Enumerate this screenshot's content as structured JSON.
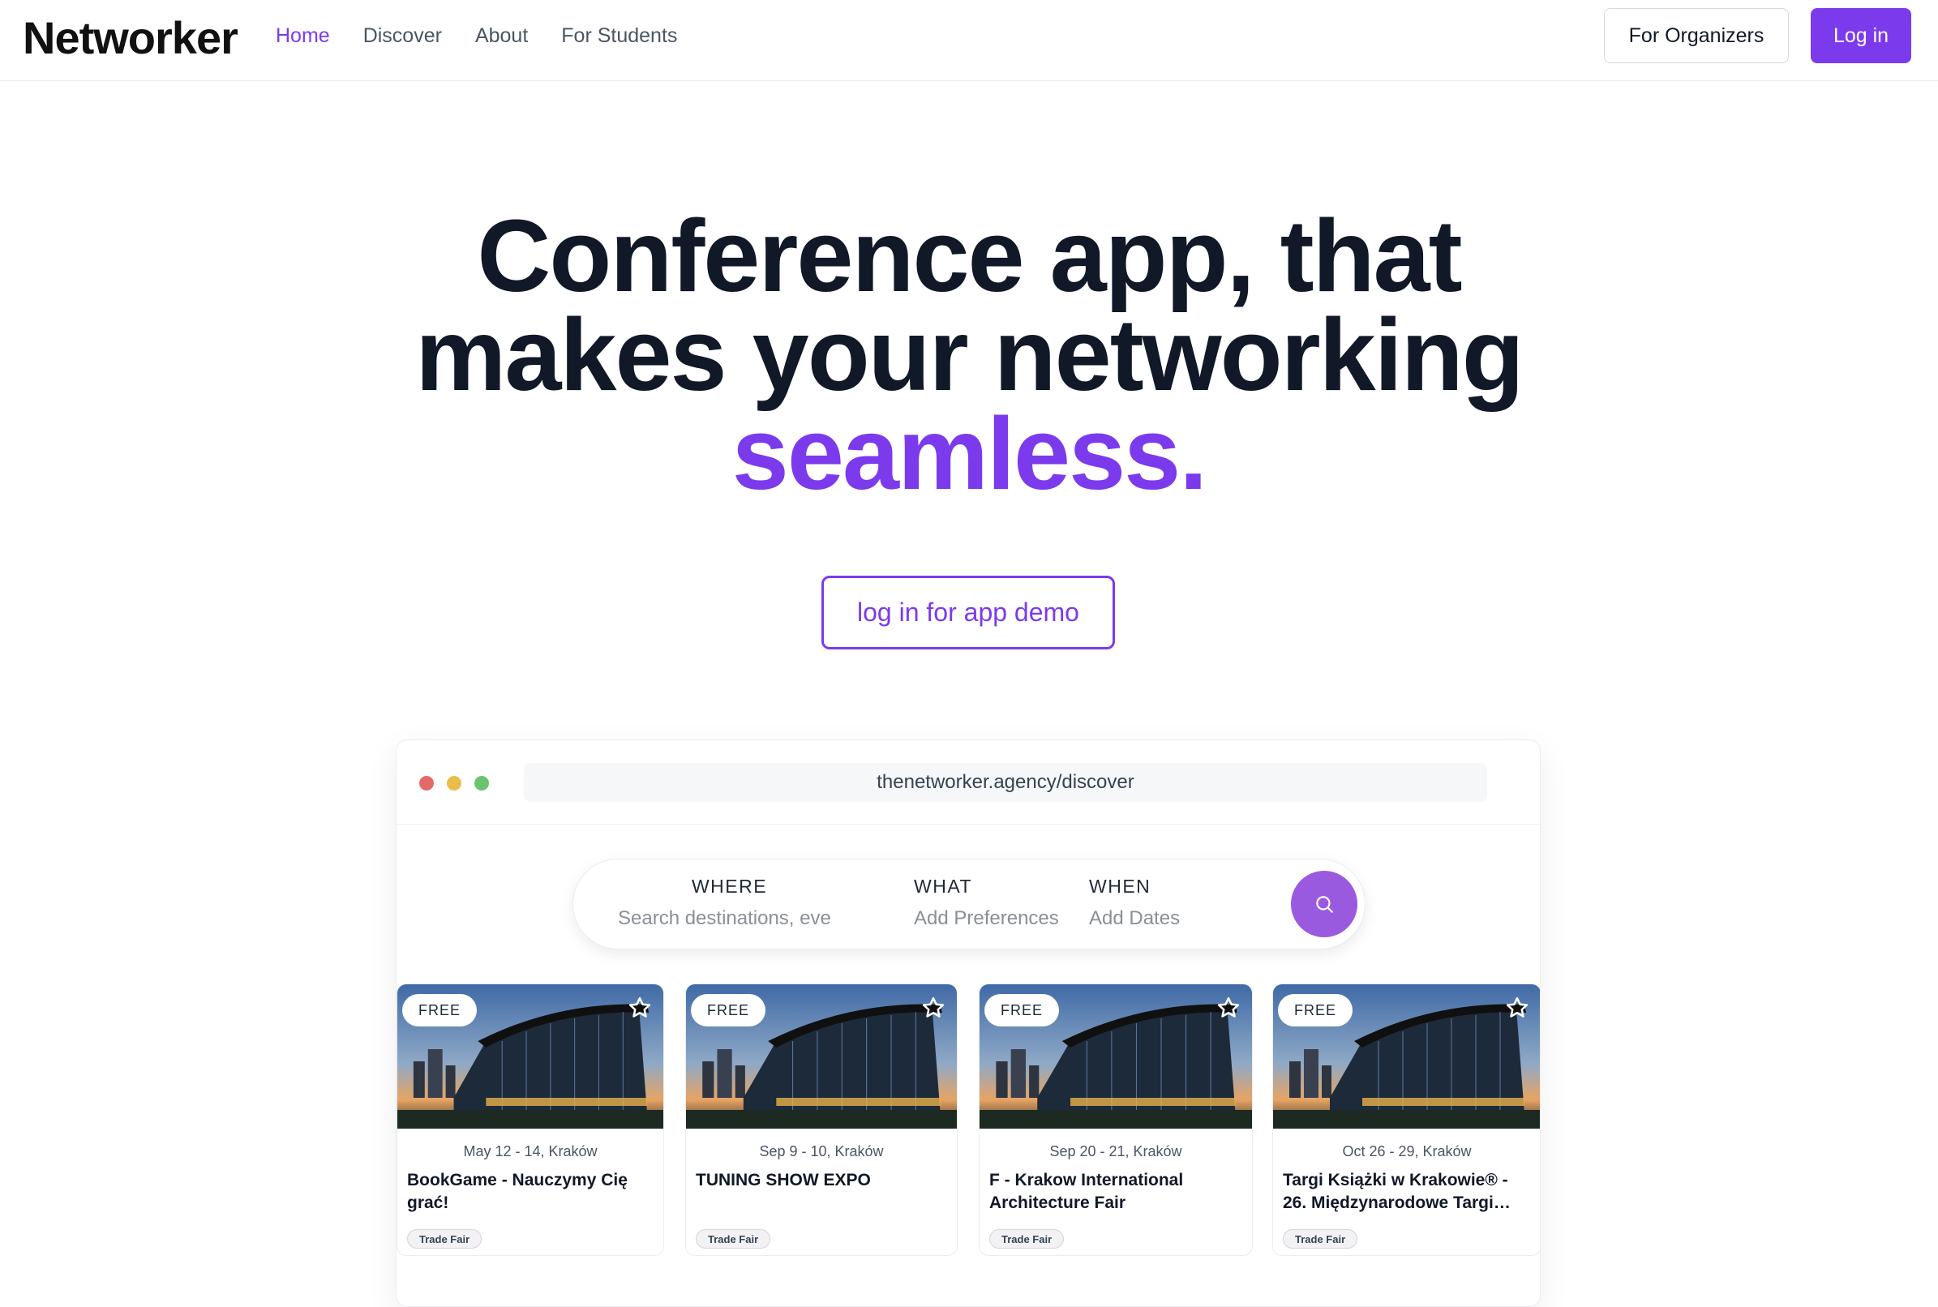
{
  "navbar": {
    "logo": "Networker",
    "links": [
      "Home",
      "Discover",
      "About",
      "For Students"
    ],
    "active_link": "Home",
    "organizers_label": "For Organizers",
    "login_label": "Log in"
  },
  "hero": {
    "line1": "Conference app, that",
    "line2": "makes your networking",
    "accent": "seamless.",
    "demo_button": "log in for app demo"
  },
  "mockup": {
    "url": "thenetworker.agency/discover",
    "search": {
      "where_label": "WHERE",
      "where_placeholder": "Search destinations, eve",
      "what_label": "WHAT",
      "what_placeholder": "Add Preferences",
      "when_label": "WHEN",
      "when_placeholder": "Add Dates",
      "button_icon": "search-icon"
    },
    "cards": [
      {
        "badge": "FREE",
        "date": "May 12 - 14, Kraków",
        "title": "BookGame - Nauczymy Cię grać!",
        "tag": "Trade Fair"
      },
      {
        "badge": "FREE",
        "date": "Sep 9 - 10, Kraków",
        "title": "TUNING SHOW EXPO",
        "tag": "Trade Fair"
      },
      {
        "badge": "FREE",
        "date": "Sep 20 - 21, Kraków",
        "title": "F - Krakow International Architecture Fair",
        "tag": "Trade Fair"
      },
      {
        "badge": "FREE",
        "date": "Oct 26 - 29, Kraków",
        "title": "Targi Książki w Krakowie® - 26. Międzynarodowe Targi…",
        "tag": "Trade Fair"
      }
    ]
  },
  "colors": {
    "accent": "#7c3aed",
    "search_button": "#9a5ae0",
    "dot_red": "#e46a6a",
    "dot_yellow": "#e8bd4c",
    "dot_green": "#6cc46f"
  }
}
